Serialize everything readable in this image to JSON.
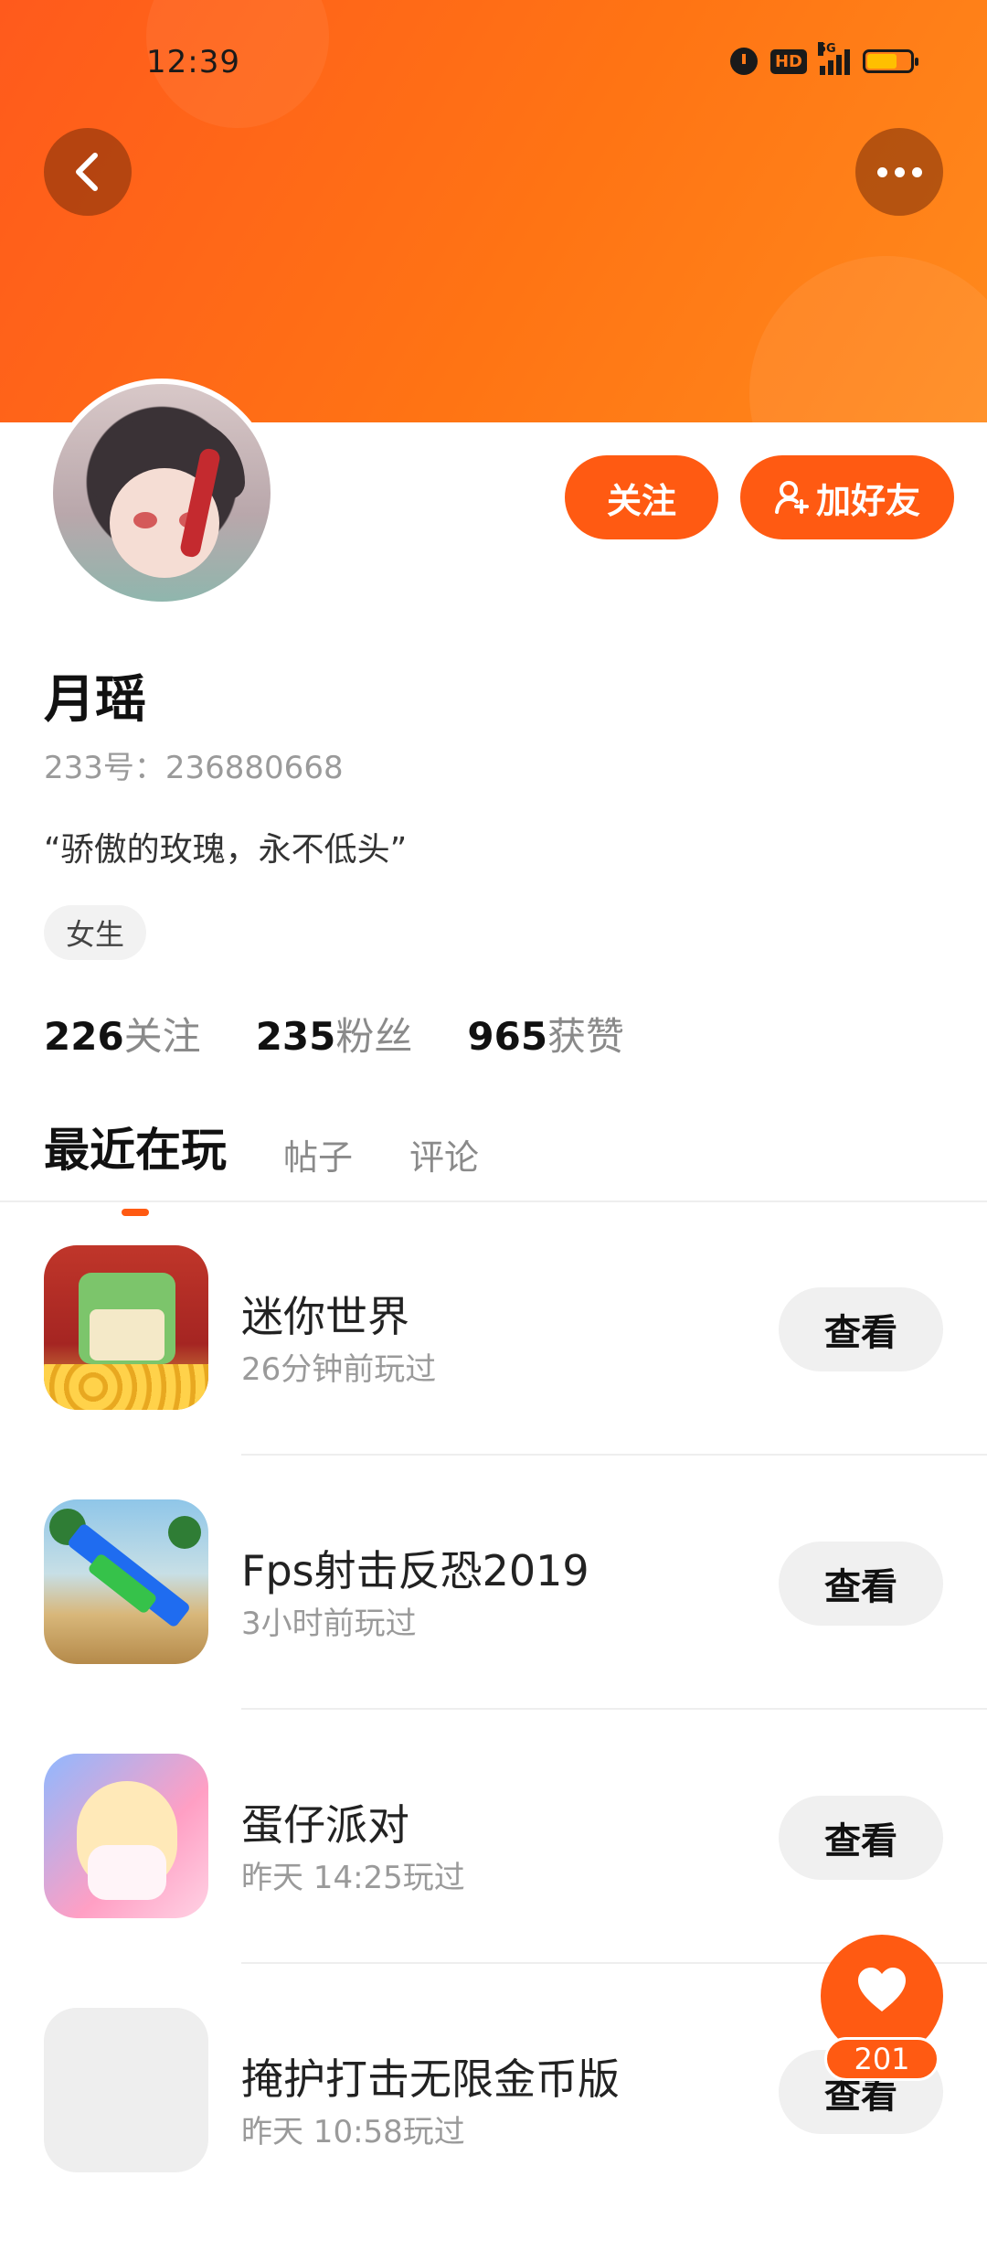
{
  "status_bar": {
    "time": "12:39",
    "network": "5G",
    "hd": "HD"
  },
  "profile": {
    "follow_label": "关注",
    "add_friend_label": "加好友",
    "name": "月瑶",
    "id_text": "233号：236880668",
    "bio": "“骄傲的玫瑰，永不低头”",
    "gender_tag": "女生",
    "stats": [
      {
        "num": "226",
        "label": "关注"
      },
      {
        "num": "235",
        "label": "粉丝"
      },
      {
        "num": "965",
        "label": "获赞"
      }
    ]
  },
  "tabs": [
    {
      "label": "最近在玩",
      "active": true
    },
    {
      "label": "帖子",
      "active": false
    },
    {
      "label": "评论",
      "active": false
    }
  ],
  "games": [
    {
      "title": "迷你世界",
      "subtitle": "26分钟前玩过",
      "button": "查看"
    },
    {
      "title": "Fps射击反恐2019",
      "subtitle": "3小时前玩过",
      "button": "查看"
    },
    {
      "title": "蛋仔派对",
      "subtitle": "昨天 14:25玩过",
      "button": "查看"
    },
    {
      "title": "掩护打击无限金币版",
      "subtitle": "昨天 10:58玩过",
      "button": "查看"
    }
  ],
  "fab": {
    "count": "201"
  },
  "colors": {
    "accent": "#ff5a12",
    "header_start": "#ff5a1c",
    "header_end": "#ff8a1c"
  }
}
